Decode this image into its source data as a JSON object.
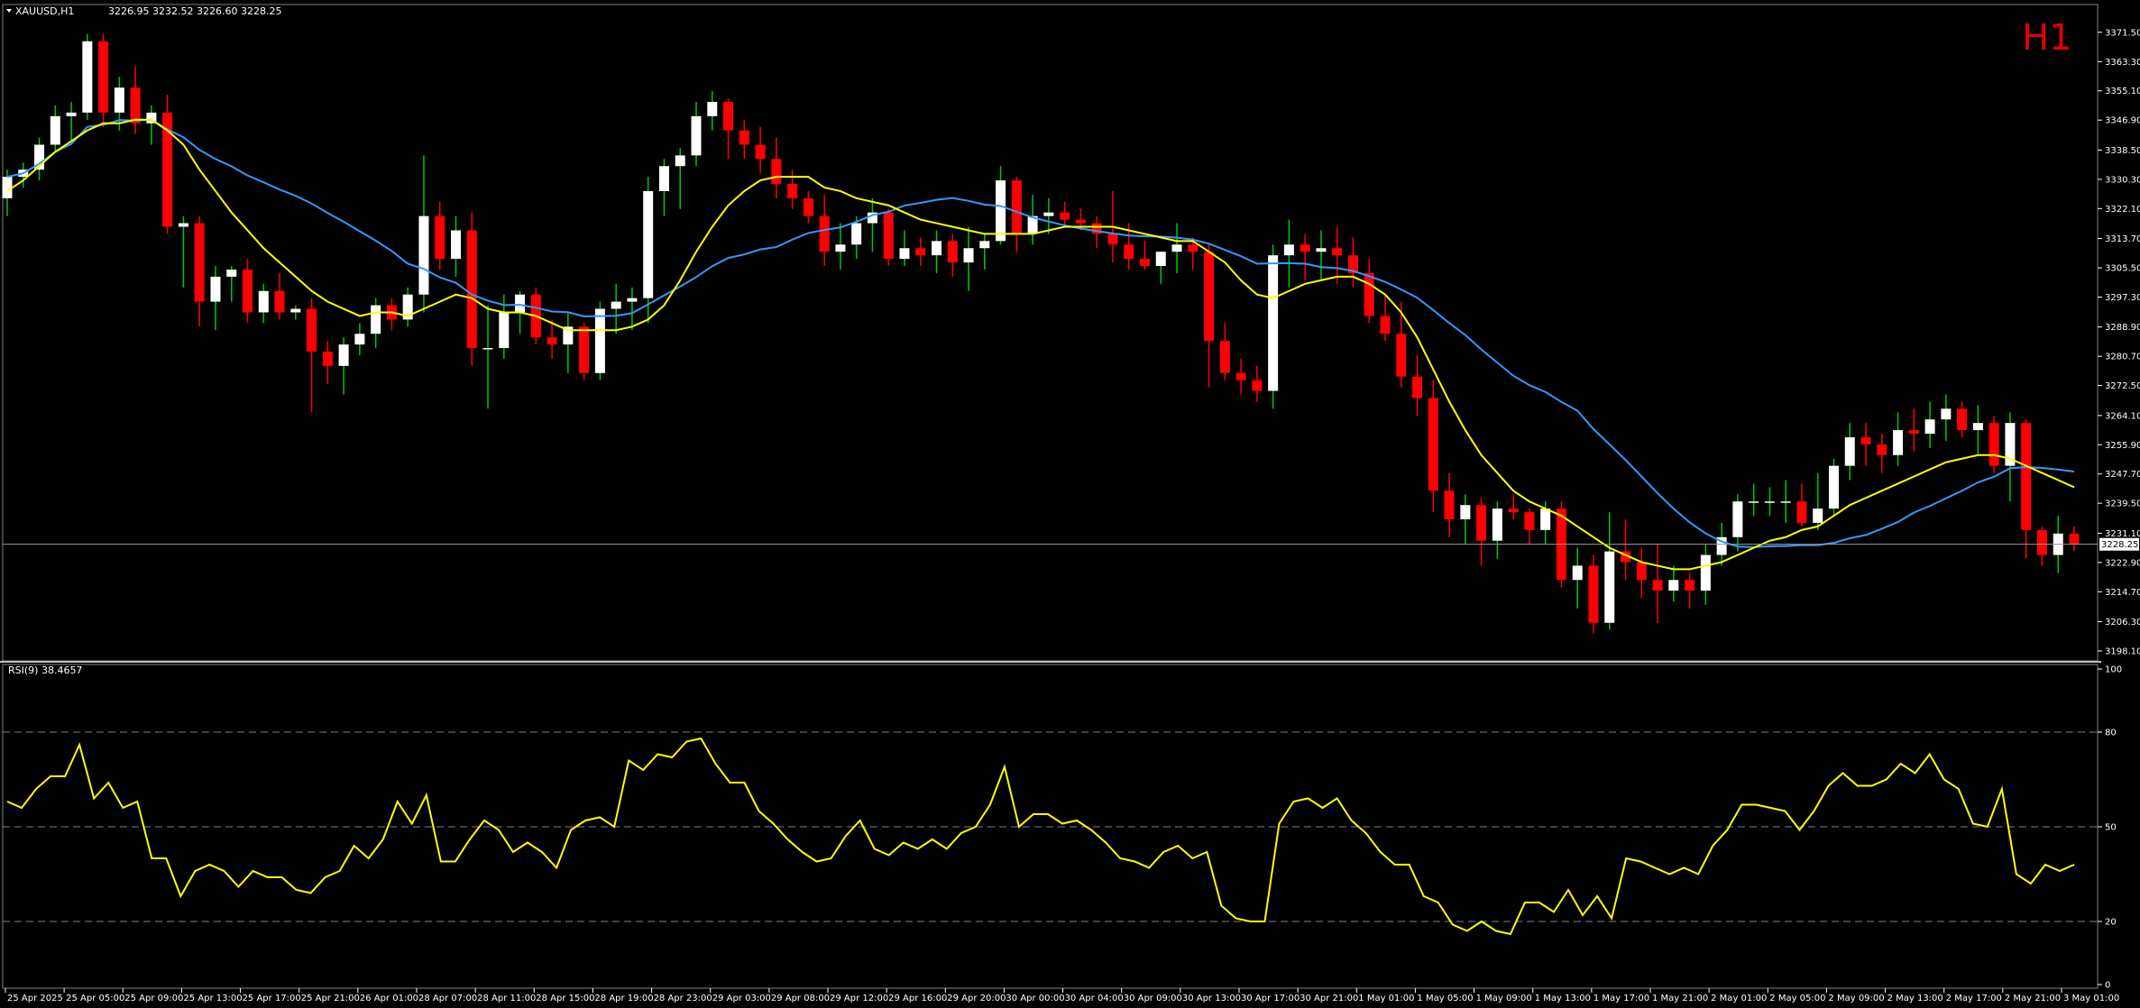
{
  "header": {
    "symbol": "XAUUSD,H1",
    "ohlc": "3226.95 3232.52 3226.60 3228.25",
    "timeframe_badge": "H1"
  },
  "price_panel": {
    "current_price_label": "3228.25",
    "y_ticks": [
      "3371.50",
      "3363.30",
      "3355.10",
      "3346.90",
      "3338.50",
      "3330.30",
      "3322.10",
      "3313.70",
      "3305.50",
      "3297.30",
      "3288.90",
      "3280.70",
      "3272.50",
      "3264.10",
      "3255.90",
      "3247.70",
      "3239.50",
      "3231.10",
      "3222.90",
      "3214.70",
      "3206.30",
      "3198.10"
    ]
  },
  "rsi_panel": {
    "label": "RSI(9) 38.4657",
    "y_ticks": [
      "100",
      "80",
      "50",
      "20",
      "0"
    ]
  },
  "x_ticks": [
    "25 Apr 2025",
    "25 Apr 05:00",
    "25 Apr 09:00",
    "25 Apr 13:00",
    "25 Apr 17:00",
    "25 Apr 21:00",
    "26 Apr 01:00",
    "28 Apr 07:00",
    "28 Apr 11:00",
    "28 Apr 15:00",
    "28 Apr 19:00",
    "28 Apr 23:00",
    "29 Apr 03:00",
    "29 Apr 08:00",
    "29 Apr 12:00",
    "29 Apr 16:00",
    "29 Apr 20:00",
    "30 Apr 00:00",
    "30 Apr 04:00",
    "30 Apr 09:00",
    "30 Apr 13:00",
    "30 Apr 17:00",
    "30 Apr 21:00",
    "1 May 01:00",
    "1 May 05:00",
    "1 May 09:00",
    "1 May 13:00",
    "1 May 17:00",
    "1 May 21:00",
    "2 May 01:00",
    "2 May 05:00",
    "2 May 09:00",
    "2 May 13:00",
    "2 May 17:00",
    "2 May 21:00",
    "3 May 01:00"
  ],
  "colors": {
    "background": "#000000",
    "bull_candle": "#ffffff",
    "bear_candle": "#ff0000",
    "wick_up": "#00c800",
    "wick_down": "#ff0000",
    "ma_fast": "#ffff00",
    "ma_slow": "#3399ff",
    "rsi_line": "#ffff00",
    "grid": "#808080"
  },
  "chart_data": {
    "type": "candlestick",
    "price_range": [
      3198.1,
      3375.0
    ],
    "candles": [
      [
        3325,
        3333,
        3320,
        3331
      ],
      [
        3331,
        3335,
        3328,
        3333
      ],
      [
        3333,
        3342,
        3330,
        3340
      ],
      [
        3340,
        3351,
        3338,
        3348
      ],
      [
        3348,
        3352,
        3340,
        3349
      ],
      [
        3349,
        3371,
        3347,
        3369
      ],
      [
        3369,
        3371,
        3345,
        3349
      ],
      [
        3349,
        3359,
        3344,
        3356
      ],
      [
        3356,
        3362,
        3343,
        3346
      ],
      [
        3346,
        3351,
        3340,
        3349
      ],
      [
        3349,
        3354,
        3315,
        3317
      ],
      [
        3317,
        3320,
        3300,
        3318
      ],
      [
        3318,
        3320,
        3289,
        3296
      ],
      [
        3296,
        3306,
        3288,
        3303
      ],
      [
        3303,
        3306,
        3296,
        3305
      ],
      [
        3305,
        3308,
        3290,
        3293
      ],
      [
        3293,
        3301,
        3290,
        3299
      ],
      [
        3299,
        3304,
        3291,
        3293
      ],
      [
        3293,
        3295,
        3291,
        3294
      ],
      [
        3294,
        3297,
        3265,
        3282
      ],
      [
        3282,
        3285,
        3273,
        3278
      ],
      [
        3278,
        3286,
        3270,
        3284
      ],
      [
        3284,
        3290,
        3281,
        3287
      ],
      [
        3287,
        3297,
        3283,
        3295
      ],
      [
        3295,
        3297,
        3288,
        3291
      ],
      [
        3291,
        3300,
        3289,
        3298
      ],
      [
        3298,
        3337,
        3293,
        3320
      ],
      [
        3320,
        3324,
        3305,
        3308
      ],
      [
        3308,
        3320,
        3303,
        3316
      ],
      [
        3316,
        3321,
        3278,
        3283
      ],
      [
        3283,
        3295,
        3266,
        3283
      ],
      [
        3283,
        3298,
        3280,
        3293
      ],
      [
        3293,
        3299,
        3287,
        3298
      ],
      [
        3298,
        3300,
        3284,
        3286
      ],
      [
        3286,
        3291,
        3280,
        3284
      ],
      [
        3284,
        3293,
        3276,
        3289
      ],
      [
        3289,
        3290,
        3274,
        3276
      ],
      [
        3276,
        3296,
        3274,
        3294
      ],
      [
        3294,
        3301,
        3287,
        3296
      ],
      [
        3296,
        3300,
        3288,
        3297
      ],
      [
        3297,
        3331,
        3290,
        3327
      ],
      [
        3327,
        3336,
        3320,
        3334
      ],
      [
        3334,
        3339,
        3322,
        3337
      ],
      [
        3337,
        3352,
        3334,
        3348
      ],
      [
        3348,
        3355,
        3344,
        3352
      ],
      [
        3352,
        3353,
        3336,
        3344
      ],
      [
        3344,
        3347,
        3336,
        3340
      ],
      [
        3340,
        3345,
        3332,
        3336
      ],
      [
        3336,
        3342,
        3325,
        3329
      ],
      [
        3329,
        3333,
        3322,
        3325
      ],
      [
        3325,
        3327,
        3318,
        3320
      ],
      [
        3320,
        3326,
        3306,
        3310
      ],
      [
        3310,
        3318,
        3305,
        3312
      ],
      [
        3312,
        3320,
        3308,
        3318
      ],
      [
        3318,
        3325,
        3310,
        3321
      ],
      [
        3321,
        3322,
        3306,
        3308
      ],
      [
        3308,
        3316,
        3306,
        3311
      ],
      [
        3311,
        3314,
        3306,
        3309
      ],
      [
        3309,
        3316,
        3304,
        3313
      ],
      [
        3313,
        3315,
        3303,
        3307
      ],
      [
        3307,
        3317,
        3299,
        3311
      ],
      [
        3311,
        3315,
        3305,
        3313
      ],
      [
        3313,
        3334,
        3312,
        3330
      ],
      [
        3330,
        3331,
        3310,
        3315
      ],
      [
        3315,
        3326,
        3312,
        3320
      ],
      [
        3320,
        3325,
        3315,
        3321
      ],
      [
        3321,
        3324,
        3317,
        3319
      ],
      [
        3319,
        3322,
        3316,
        3318
      ],
      [
        3318,
        3320,
        3311,
        3315
      ],
      [
        3315,
        3327,
        3307,
        3312
      ],
      [
        3312,
        3318,
        3305,
        3308
      ],
      [
        3308,
        3313,
        3305,
        3306
      ],
      [
        3306,
        3310,
        3301,
        3310
      ],
      [
        3310,
        3318,
        3304,
        3312
      ],
      [
        3312,
        3314,
        3305,
        3310
      ],
      [
        3310,
        3312,
        3272,
        3285
      ],
      [
        3285,
        3290,
        3274,
        3276
      ],
      [
        3276,
        3280,
        3270,
        3274
      ],
      [
        3274,
        3278,
        3268,
        3271
      ],
      [
        3271,
        3312,
        3266,
        3309
      ],
      [
        3309,
        3319,
        3300,
        3312
      ],
      [
        3312,
        3315,
        3302,
        3310
      ],
      [
        3310,
        3316,
        3302,
        3311
      ],
      [
        3311,
        3317,
        3301,
        3309
      ],
      [
        3309,
        3314,
        3300,
        3304
      ],
      [
        3304,
        3308,
        3290,
        3292
      ],
      [
        3292,
        3298,
        3285,
        3287
      ],
      [
        3287,
        3296,
        3272,
        3275
      ],
      [
        3275,
        3281,
        3264,
        3269
      ],
      [
        3269,
        3274,
        3237,
        3243
      ],
      [
        3243,
        3248,
        3230,
        3235
      ],
      [
        3235,
        3242,
        3228,
        3239
      ],
      [
        3239,
        3241,
        3222,
        3229
      ],
      [
        3229,
        3240,
        3224,
        3238
      ],
      [
        3238,
        3242,
        3235,
        3237
      ],
      [
        3237,
        3238,
        3228,
        3232
      ],
      [
        3232,
        3240,
        3228,
        3238
      ],
      [
        3238,
        3240,
        3216,
        3218
      ],
      [
        3218,
        3227,
        3210,
        3222
      ],
      [
        3222,
        3225,
        3203,
        3206
      ],
      [
        3206,
        3237,
        3204,
        3226
      ],
      [
        3226,
        3235,
        3218,
        3223
      ],
      [
        3223,
        3227,
        3213,
        3218
      ],
      [
        3218,
        3228,
        3206,
        3215
      ],
      [
        3215,
        3222,
        3212,
        3218
      ],
      [
        3218,
        3220,
        3210,
        3215
      ],
      [
        3215,
        3228,
        3211,
        3225
      ],
      [
        3225,
        3234,
        3222,
        3230
      ],
      [
        3230,
        3242,
        3226,
        3240
      ],
      [
        3240,
        3245,
        3236,
        3240
      ],
      [
        3240,
        3244,
        3236,
        3240
      ],
      [
        3240,
        3246,
        3234,
        3240
      ],
      [
        3240,
        3245,
        3233,
        3234
      ],
      [
        3234,
        3248,
        3232,
        3238
      ],
      [
        3238,
        3252,
        3236,
        3250
      ],
      [
        3250,
        3262,
        3246,
        3258
      ],
      [
        3258,
        3262,
        3250,
        3256
      ],
      [
        3256,
        3259,
        3248,
        3253
      ],
      [
        3253,
        3265,
        3250,
        3260
      ],
      [
        3260,
        3266,
        3254,
        3259
      ],
      [
        3259,
        3268,
        3255,
        3263
      ],
      [
        3263,
        3270,
        3257,
        3266
      ],
      [
        3266,
        3268,
        3258,
        3260
      ],
      [
        3260,
        3267,
        3253,
        3262
      ],
      [
        3262,
        3264,
        3248,
        3250
      ],
      [
        3250,
        3265,
        3240,
        3262
      ],
      [
        3262,
        3263,
        3224,
        3232
      ],
      [
        3232,
        3233,
        3222,
        3225
      ],
      [
        3225,
        3236,
        3220,
        3231
      ],
      [
        3231,
        3233,
        3226,
        3228
      ]
    ],
    "ma_fast": [
      3327,
      3330,
      3334,
      3338,
      3341,
      3344,
      3346,
      3346,
      3347,
      3347,
      3344,
      3340,
      3333,
      3327,
      3321,
      3316,
      3311,
      3307,
      3303,
      3299,
      3296,
      3294,
      3292,
      3293,
      3293,
      3292,
      3294,
      3296,
      3298,
      3297,
      3294,
      3293,
      3293,
      3292,
      3290,
      3288,
      3288,
      3288,
      3288,
      3289,
      3291,
      3295,
      3302,
      3310,
      3317,
      3323,
      3327,
      3330,
      3331,
      3331,
      3331,
      3328,
      3327,
      3325,
      3324,
      3323,
      3321,
      3319,
      3318,
      3317,
      3316,
      3315,
      3315,
      3315,
      3315,
      3316,
      3317,
      3317,
      3317,
      3317,
      3316,
      3315,
      3314,
      3313,
      3313,
      3310,
      3307,
      3302,
      3298,
      3297,
      3299,
      3301,
      3302,
      3303,
      3303,
      3301,
      3298,
      3293,
      3286,
      3277,
      3268,
      3260,
      3253,
      3248,
      3243,
      3240,
      3238,
      3236,
      3233,
      3230,
      3227,
      3225,
      3223,
      3222,
      3221,
      3221,
      3222,
      3223,
      3225,
      3227,
      3229,
      3230,
      3232,
      3233,
      3236,
      3239,
      3241,
      3243,
      3245,
      3247,
      3249,
      3251,
      3252,
      3253,
      3253,
      3252,
      3250,
      3248,
      3246,
      3244
    ]
  },
  "rsi_data": {
    "range": [
      0,
      100
    ],
    "levels": [
      80,
      50,
      20
    ],
    "values": [
      58,
      56,
      62,
      66,
      66,
      76,
      59,
      64,
      56,
      58,
      40,
      40,
      28,
      36,
      38,
      36,
      31,
      36,
      34,
      34,
      30,
      29,
      34,
      36,
      44,
      40,
      46,
      58,
      51,
      60,
      39,
      39,
      46,
      52,
      49,
      42,
      45,
      42,
      37,
      49,
      52,
      53,
      50,
      71,
      68,
      73,
      72,
      77,
      78,
      70,
      64,
      64,
      55,
      51,
      46,
      42,
      39,
      40,
      47,
      52,
      43,
      41,
      45,
      43,
      46,
      43,
      48,
      50,
      57,
      69,
      50,
      54,
      54,
      51,
      52,
      49,
      45,
      40,
      39,
      37,
      42,
      44,
      40,
      42,
      25,
      21,
      20,
      20,
      51,
      58,
      59,
      56,
      59,
      52,
      48,
      42,
      38,
      38,
      28,
      26,
      19,
      17,
      20,
      17,
      16,
      26,
      26,
      23,
      30,
      22,
      28,
      21,
      40,
      39,
      37,
      35,
      37,
      35,
      44,
      49,
      57,
      57,
      56,
      55,
      49,
      55,
      63,
      67,
      63,
      63,
      65,
      70,
      67,
      73,
      65,
      62,
      51,
      50,
      62,
      35,
      32,
      38,
      36,
      38
    ]
  }
}
